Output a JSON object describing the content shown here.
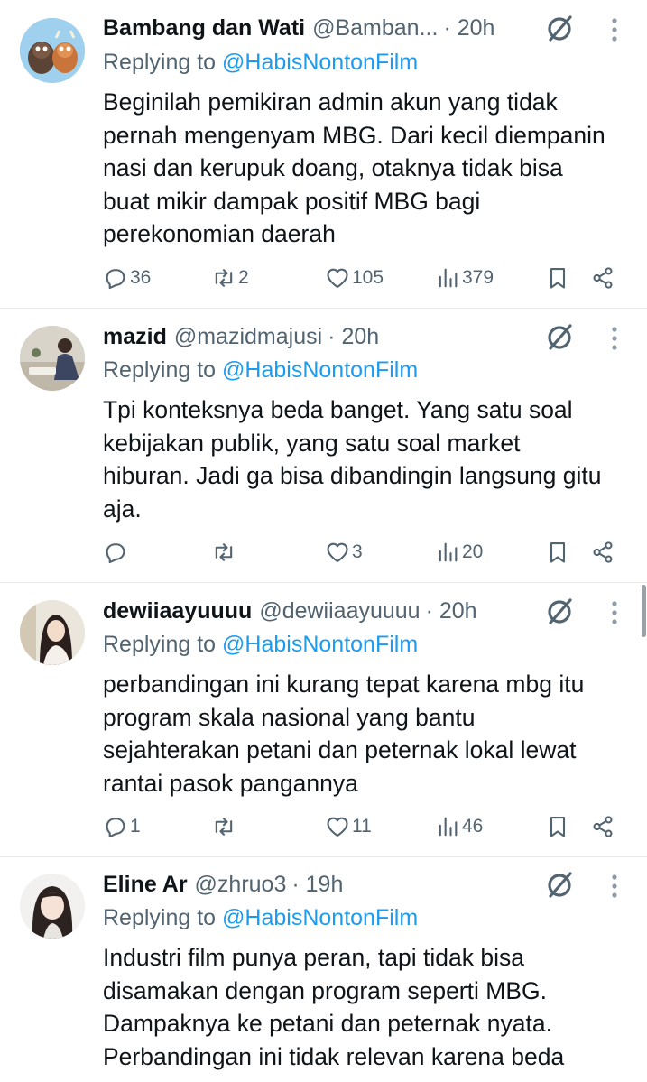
{
  "replies": [
    {
      "name": "Bambang dan Wati",
      "handle": "@Bamban...",
      "time": "· 20h",
      "replying_prefix": "Replying to ",
      "replying_to": "@HabisNontonFilm",
      "lines": [
        "Beginilah pemikiran admin akun yang tidak",
        "pernah mengenyam MBG. Dari kecil diempanin",
        "nasi dan kerupuk doang, otaknya tidak bisa",
        "buat mikir dampak positif MBG bagi",
        "perekonomian daerah"
      ],
      "stats": {
        "replies": "36",
        "reposts": "2",
        "likes": "105",
        "views": "379"
      }
    },
    {
      "name": "mazid",
      "handle": "@mazidmajusi",
      "time": "· 20h",
      "replying_prefix": "Replying to ",
      "replying_to": "@HabisNontonFilm",
      "lines": [
        "Tpi konteksnya beda banget. Yang satu soal",
        "kebijakan publik, yang satu soal market",
        "hiburan. Jadi ga bisa dibandingin langsung gitu",
        "aja."
      ],
      "stats": {
        "replies": "",
        "reposts": "",
        "likes": "3",
        "views": "20"
      }
    },
    {
      "name": "dewiiaayuuuu",
      "handle": "@dewiiaayuuuu",
      "time": "· 20h",
      "replying_prefix": "Replying to ",
      "replying_to": "@HabisNontonFilm",
      "lines": [
        "perbandingan ini kurang tepat karena mbg itu",
        "program skala nasional yang bantu",
        "sejahterakan petani dan peternak lokal lewat",
        "rantai pasok pangannya"
      ],
      "stats": {
        "replies": "1",
        "reposts": "",
        "likes": "11",
        "views": "46"
      }
    },
    {
      "name": "Eline Ar",
      "handle": "@zhruo3",
      "time": "· 19h",
      "replying_prefix": "Replying to ",
      "replying_to": "@HabisNontonFilm",
      "lines": [
        "Industri film punya peran, tapi tidak bisa",
        "disamakan dengan program seperti MBG.",
        "Dampaknya ke petani dan peternak nyata.",
        "Perbandingan ini tidak relevan karena beda"
      ],
      "stats": null
    }
  ],
  "icons": {
    "reply": "reply-icon",
    "repost": "repost-icon",
    "like": "heart-icon",
    "views": "views-icon",
    "bookmark": "bookmark-icon",
    "share": "share-icon",
    "grok": "grok-icon",
    "more": "more-icon"
  },
  "colors": {
    "link": "#1d9bf0",
    "muted": "#536471",
    "text": "#0f1419",
    "divider": "#e6ebef"
  }
}
